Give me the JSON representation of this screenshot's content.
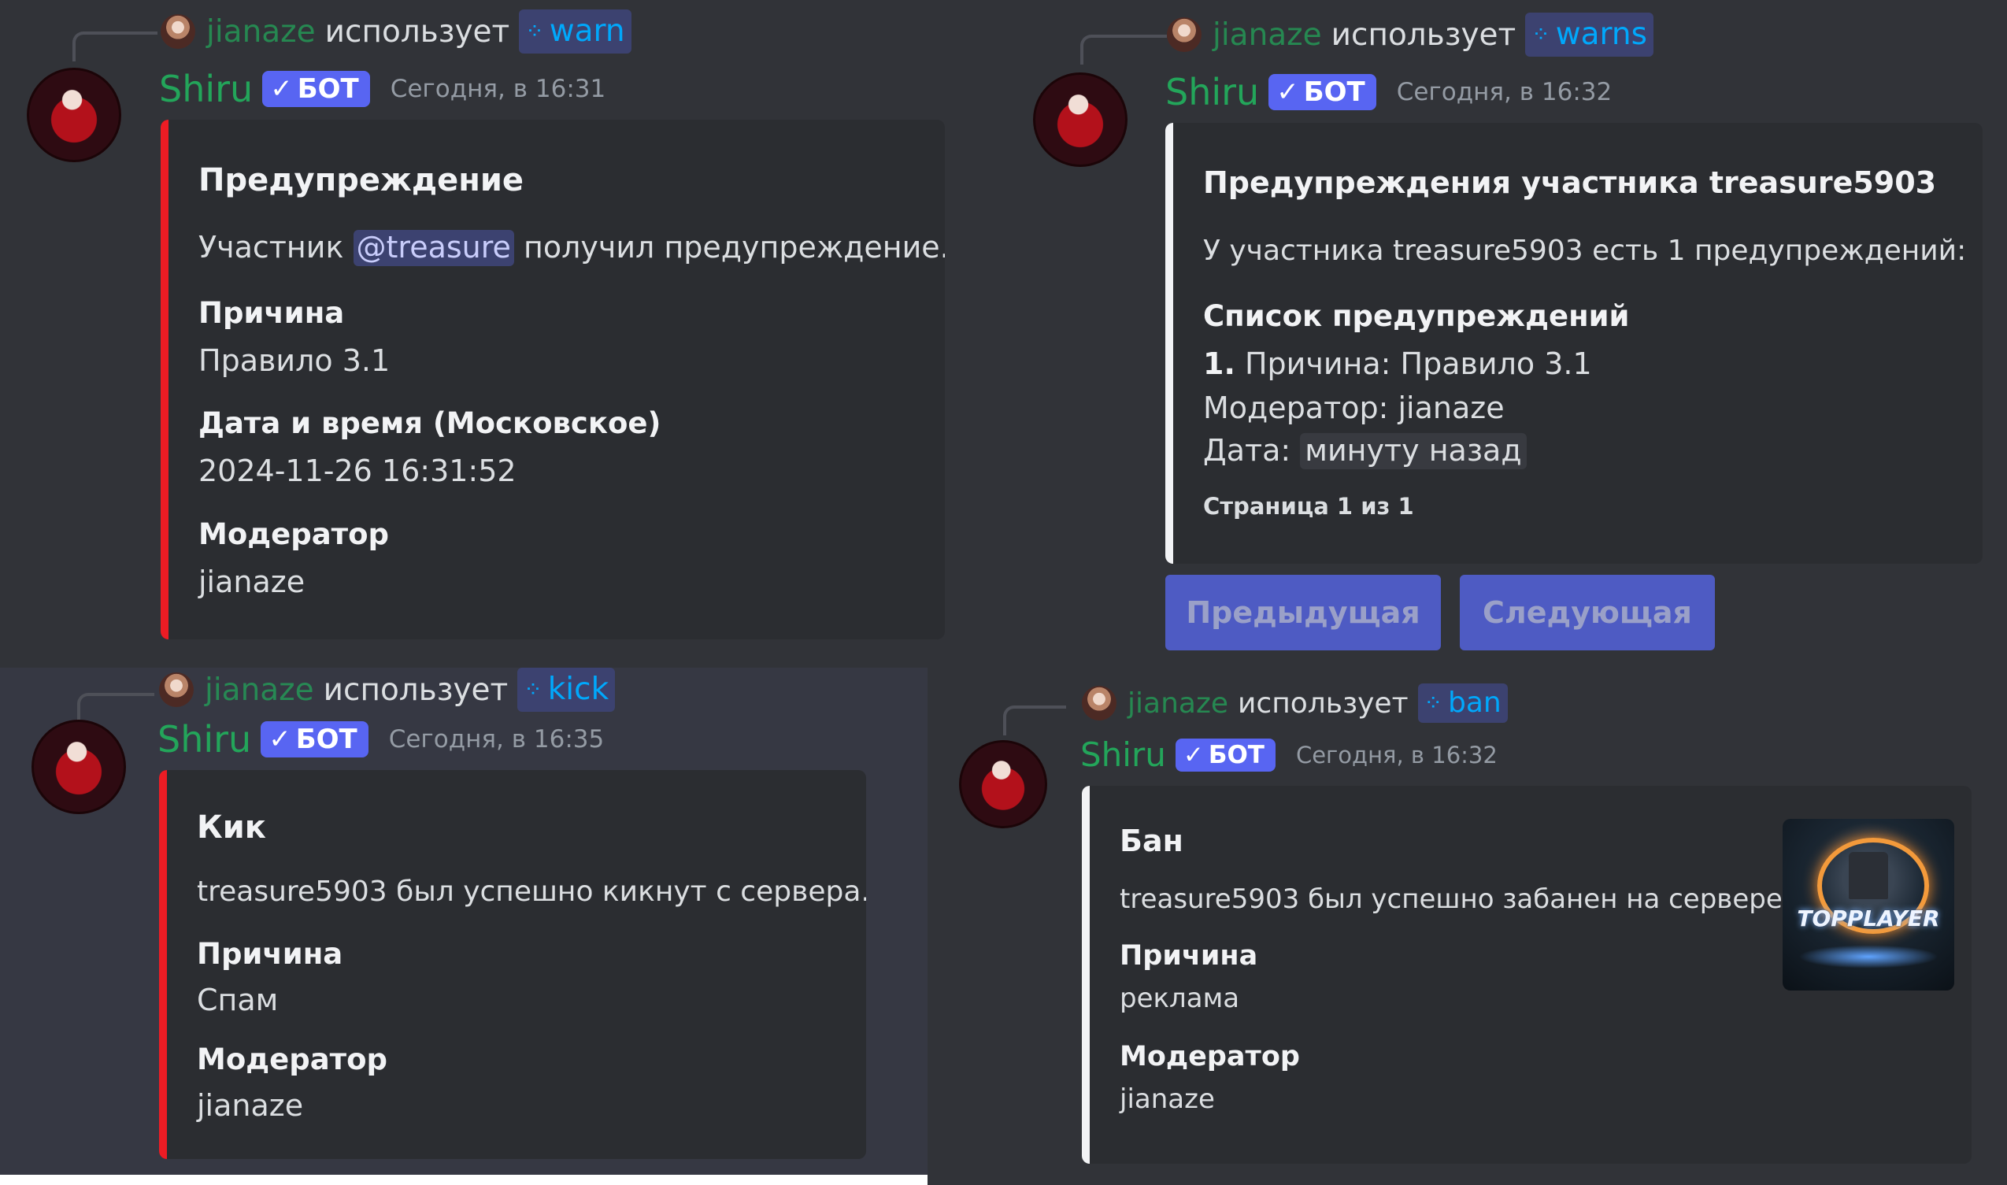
{
  "colors": {
    "bar_red": "#ed1c24",
    "bar_white": "#f2f3f5",
    "username_green": "#23a55a",
    "badge_blurple": "#5865f2",
    "command_blue": "#00a8fc"
  },
  "icons": {
    "command": "slash-command-icon",
    "badge_check": "verified-check-icon"
  },
  "common": {
    "bot_name": "Shiru",
    "bot_badge": "БОТ",
    "uses_text": "использует",
    "invoker": "jianaze"
  },
  "warn": {
    "command": "warn",
    "timestamp": "Сегодня, в 16:31",
    "title": "Предупреждение",
    "desc_prefix": "Участник",
    "mention": "@treasure",
    "desc_suffix": "получил предупреждение.",
    "fields": [
      {
        "name": "Причина",
        "value": "Правило 3.1"
      },
      {
        "name": "Дата и время (Московское)",
        "value": "2024-11-26 16:31:52"
      },
      {
        "name": "Модератор",
        "value": "jianaze"
      }
    ]
  },
  "warns": {
    "command": "warns",
    "timestamp": "Сегодня, в 16:32",
    "title": "Предупреждения участника treasure5903",
    "description": "У участника treasure5903 есть 1 предупреждений:",
    "list_title": "Список предупреждений",
    "item_number": "1.",
    "item_reason": "Причина: Правило 3.1",
    "item_moderator": "Модератор: jianaze",
    "item_date_label": "Дата:",
    "item_date_value": "минуту назад",
    "footer": "Страница 1 из 1",
    "buttons": {
      "prev": "Предыдущая",
      "next": "Следующая"
    }
  },
  "kick": {
    "command": "kick",
    "timestamp": "Сегодня, в 16:35",
    "title": "Кик",
    "description": "treasure5903 был успешно кикнут с сервера.",
    "fields": [
      {
        "name": "Причина",
        "value": "Спам"
      },
      {
        "name": "Модератор",
        "value": "jianaze"
      }
    ]
  },
  "ban": {
    "command": "ban",
    "timestamp": "Сегодня, в 16:32",
    "title": "Бан",
    "description": "treasure5903 был успешно забанен на сервере.",
    "fields": [
      {
        "name": "Причина",
        "value": "реклама"
      },
      {
        "name": "Модератор",
        "value": "jianaze"
      }
    ],
    "thumbnail_text": "TOPPLAYER"
  }
}
